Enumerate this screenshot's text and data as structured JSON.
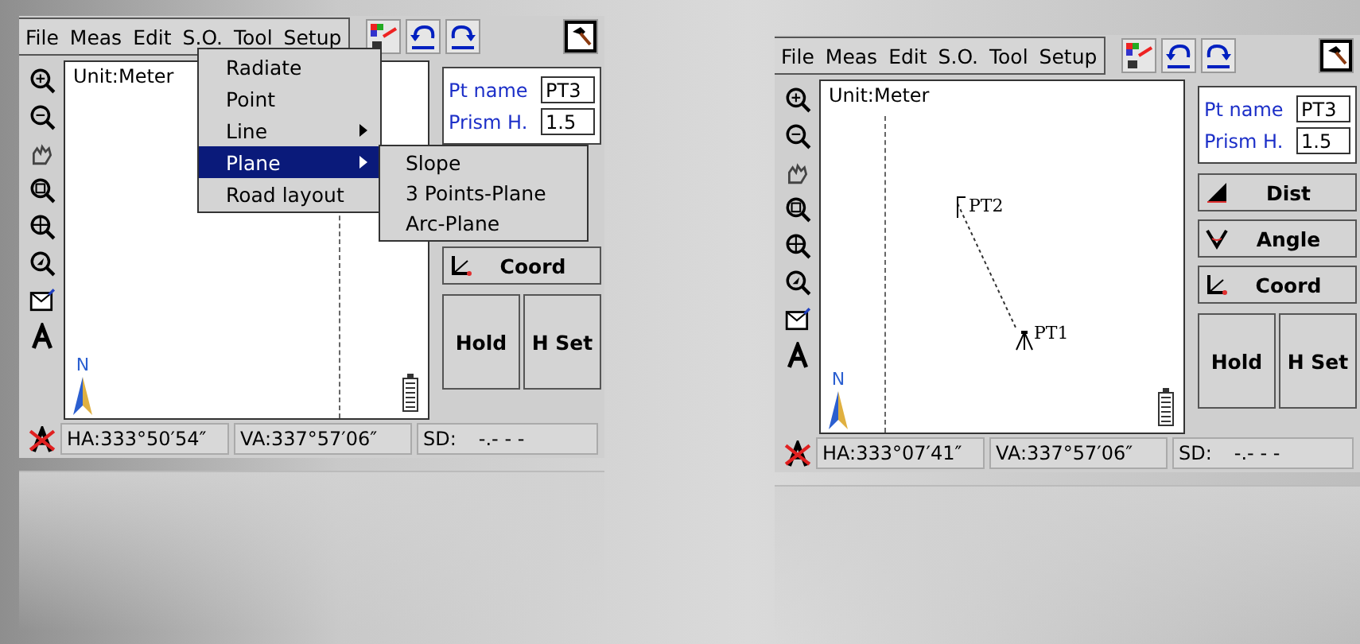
{
  "screens": [
    {
      "menu_bar": [
        "File",
        "Meas",
        "Edit",
        "S.O.",
        "Tool",
        "Setup"
      ],
      "menu": {
        "items": [
          {
            "label": "Radiate",
            "has_submenu": false,
            "selected": false
          },
          {
            "label": "Point",
            "has_submenu": false,
            "selected": false
          },
          {
            "label": "Line",
            "has_submenu": true,
            "selected": false
          },
          {
            "label": "Plane",
            "has_submenu": true,
            "selected": true
          },
          {
            "label": "Road layout",
            "has_submenu": false,
            "selected": false
          }
        ],
        "submenu": [
          "Slope",
          "3 Points-Plane",
          "Arc-Plane"
        ]
      },
      "map": {
        "unit_label": "Unit:Meter",
        "north_label": "N"
      },
      "point_form": {
        "pt_name_label": "Pt name",
        "pt_name_value": "PT3",
        "prism_label": "Prism H.",
        "prism_value": "1.5"
      },
      "measure_buttons": [
        {
          "label": "Coord",
          "kind": "coord"
        }
      ],
      "hold_button": "Hold",
      "hset_button": "H Set",
      "status": {
        "ha": "HA:333°50′54″",
        "va": "VA:337°57′06″",
        "sd": "SD:",
        "sd_value": "-.- - -"
      }
    },
    {
      "menu_bar": [
        "File",
        "Meas",
        "Edit",
        "S.O.",
        "Tool",
        "Setup"
      ],
      "map": {
        "unit_label": "Unit:Meter",
        "north_label": "N",
        "points": [
          {
            "label": "PT2",
            "kind": "flag"
          },
          {
            "label": "PT1",
            "kind": "station"
          }
        ]
      },
      "point_form": {
        "pt_name_label": "Pt name",
        "pt_name_value": "PT3",
        "prism_label": "Prism H.",
        "prism_value": "1.5"
      },
      "measure_buttons": [
        {
          "label": "Dist",
          "kind": "dist"
        },
        {
          "label": "Angle",
          "kind": "angle"
        },
        {
          "label": "Coord",
          "kind": "coord"
        }
      ],
      "hold_button": "Hold",
      "hset_button": "H Set",
      "status": {
        "ha": "HA:333°07′41″",
        "va": "VA:337°57′06″",
        "sd": "SD:",
        "sd_value": "-.- - -"
      }
    }
  ]
}
